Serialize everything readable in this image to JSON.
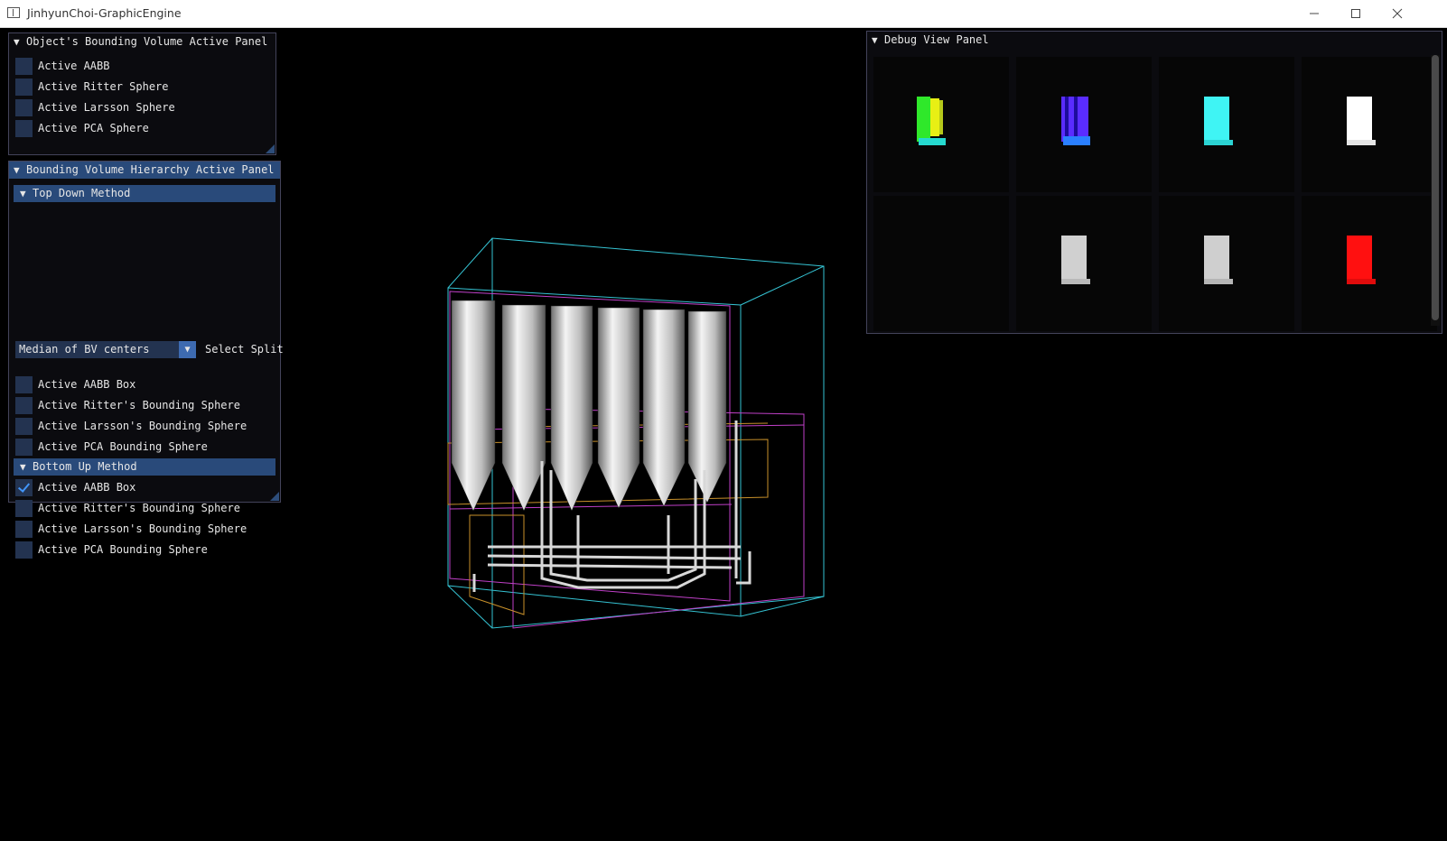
{
  "window": {
    "title": "JinhyunChoi-GraphicEngine"
  },
  "object_panel": {
    "title": "Object's Bounding Volume Active Panel",
    "items": [
      {
        "label": "Active AABB",
        "checked": false
      },
      {
        "label": "Active Ritter Sphere",
        "checked": false
      },
      {
        "label": "Active Larsson Sphere",
        "checked": false
      },
      {
        "label": "Active PCA Sphere",
        "checked": false
      }
    ]
  },
  "bvh_panel": {
    "title": "Bounding Volume Hierarchy Active Panel",
    "top_down": {
      "title": "Top Down Method",
      "split_value": "Median of BV centers",
      "split_label": "Select Split",
      "items": [
        {
          "label": "Active AABB Box",
          "checked": false
        },
        {
          "label": "Active Ritter's Bounding Sphere",
          "checked": false
        },
        {
          "label": "Active Larsson's Bounding Sphere",
          "checked": false
        },
        {
          "label": "Active PCA Bounding Sphere",
          "checked": false
        }
      ]
    },
    "bottom_up": {
      "title": "Bottom Up Method",
      "items": [
        {
          "label": "Active AABB Box",
          "checked": true
        },
        {
          "label": "Active Ritter's Bounding Sphere",
          "checked": false
        },
        {
          "label": "Active Larsson's Bounding Sphere",
          "checked": false
        },
        {
          "label": "Active PCA Bounding Sphere",
          "checked": false
        }
      ]
    }
  },
  "debug_panel": {
    "title": "Debug View Panel",
    "tiles": [
      {
        "name": "debug-tile-1",
        "color": "#3adf2a"
      },
      {
        "name": "debug-tile-2",
        "color": "#5a2cff"
      },
      {
        "name": "debug-tile-3",
        "color": "#3ff4f4"
      },
      {
        "name": "debug-tile-4",
        "color": "#ffffff"
      },
      {
        "name": "debug-tile-5",
        "color": ""
      },
      {
        "name": "debug-tile-6",
        "color": "#d0d0d0"
      },
      {
        "name": "debug-tile-7",
        "color": "#cfcfcf"
      },
      {
        "name": "debug-tile-8",
        "color": "#ff1010"
      }
    ]
  },
  "colors": {
    "panel_bg": "#0c0c10",
    "header_active": "#294a7a",
    "checkbox_bg": "#233350",
    "check_mark": "#4296fa",
    "aabb_cyan": "#35c3d3",
    "bvh_magenta": "#c040c8",
    "bvh_orange": "#c8902a"
  },
  "icons": {
    "collapse": "triangle-down-icon",
    "minimize": "minimize-icon",
    "maximize": "maximize-icon",
    "close": "close-icon"
  }
}
